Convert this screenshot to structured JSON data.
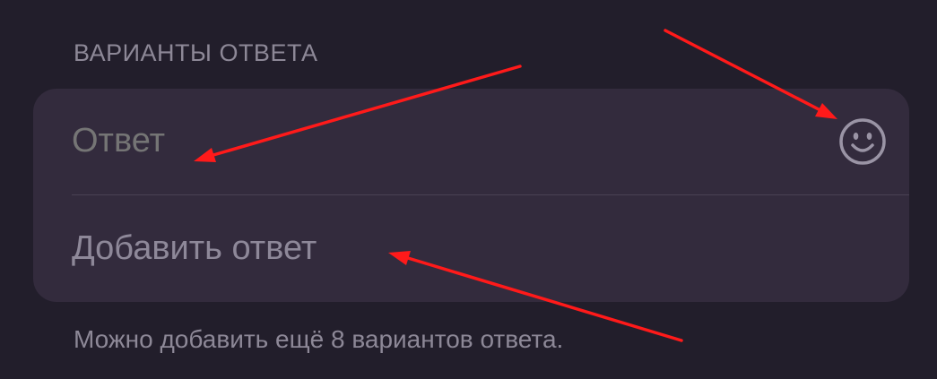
{
  "section": {
    "header": "ВАРИАНТЫ ОТВЕТА"
  },
  "answer_input": {
    "placeholder": "Ответ",
    "icon": "smiley-icon"
  },
  "add_option": {
    "label": "Добавить ответ"
  },
  "footer": {
    "note": "Можно добавить ещё 8 вариантов ответа."
  },
  "colors": {
    "background": "#221e2b",
    "card": "#332b3d",
    "text_secondary": "#8d8897",
    "annotation_arrow": "#ff1a1a"
  }
}
